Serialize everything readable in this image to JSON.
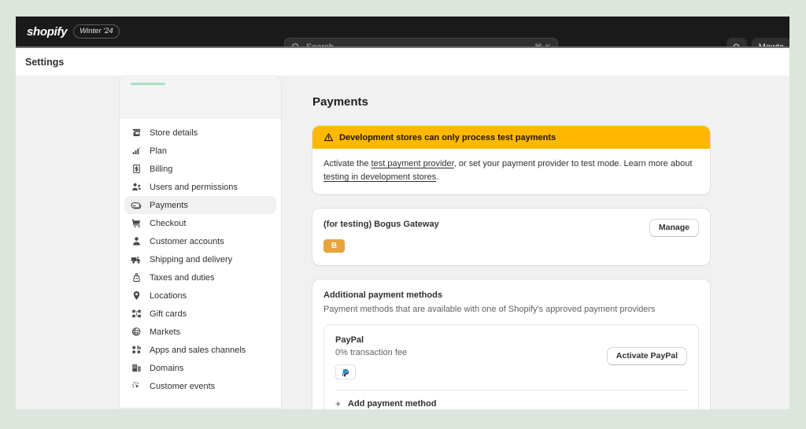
{
  "topbar": {
    "wordmark": "shopify",
    "season_badge": "Winter '24",
    "search_placeholder": "Search",
    "search_value": "",
    "kbd_hint": "⌘ K",
    "notifications_icon": "bell-icon",
    "user_name": "Mawta"
  },
  "page": {
    "header_title": "Settings",
    "heading": "Payments"
  },
  "sidebar": {
    "items": [
      {
        "label": "Store details",
        "icon": "store-icon",
        "active": false
      },
      {
        "label": "Plan",
        "icon": "chart-bar-icon",
        "active": false
      },
      {
        "label": "Billing",
        "icon": "receipt-icon",
        "active": false
      },
      {
        "label": "Users and permissions",
        "icon": "users-icon",
        "active": false
      },
      {
        "label": "Payments",
        "icon": "credit-card-icon",
        "active": true
      },
      {
        "label": "Checkout",
        "icon": "shopping-cart-icon",
        "active": false
      },
      {
        "label": "Customer accounts",
        "icon": "person-icon",
        "active": false
      },
      {
        "label": "Shipping and delivery",
        "icon": "truck-icon",
        "active": false
      },
      {
        "label": "Taxes and duties",
        "icon": "tax-weight-icon",
        "active": false
      },
      {
        "label": "Locations",
        "icon": "location-pin-icon",
        "active": false
      },
      {
        "label": "Gift cards",
        "icon": "gift-card-icon",
        "active": false
      },
      {
        "label": "Markets",
        "icon": "globe-icon",
        "active": false
      },
      {
        "label": "Apps and sales channels",
        "icon": "apps-grid-icon",
        "active": false
      },
      {
        "label": "Domains",
        "icon": "domains-icon",
        "active": false
      },
      {
        "label": "Customer events",
        "icon": "cursor-click-icon",
        "active": false
      }
    ]
  },
  "banner": {
    "icon": "warning-triangle-icon",
    "title": "Development stores can only process test payments",
    "body_part1": "Activate the ",
    "link1": "test payment provider",
    "body_part2": ", or set your payment provider to test mode. Learn more about ",
    "link2": "testing in development stores",
    "body_part3": ".",
    "accent_color": "#ffb800"
  },
  "gateway_card": {
    "title": "(for testing) Bogus Gateway",
    "manage_button": "Manage",
    "badge_letter": "B",
    "badge_color": "#e8a33d"
  },
  "additional_payment_methods": {
    "title": "Additional payment methods",
    "subtitle": "Payment methods that are available with one of Shopify's approved payment providers",
    "methods": [
      {
        "name": "PayPal",
        "fee": "0% transaction fee",
        "logo": "paypal-logo",
        "action_label": "Activate PayPal"
      }
    ],
    "add_method_label": "Add payment method"
  }
}
